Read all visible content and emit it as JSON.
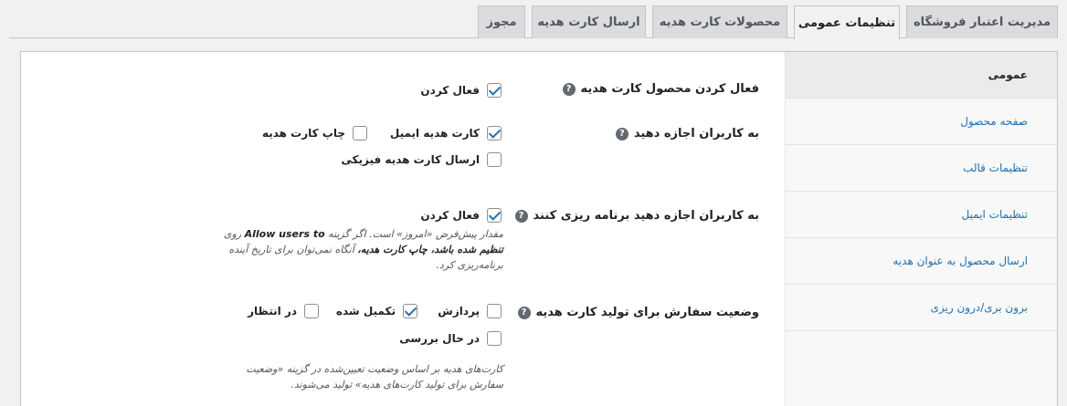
{
  "tabs": [
    {
      "label": "مدیریت اعتبار فروشگاه",
      "active": false
    },
    {
      "label": "تنظیمات عمومی",
      "active": true
    },
    {
      "label": "محصولات کارت هدیه",
      "active": false
    },
    {
      "label": "ارسال کارت هدیه",
      "active": false
    },
    {
      "label": "مجوز",
      "active": false
    }
  ],
  "sidebar": {
    "items": [
      {
        "label": "عمومی",
        "active": true
      },
      {
        "label": "صفحه محصول"
      },
      {
        "label": "تنظیمات قالب"
      },
      {
        "label": "تنظیمات ایمیل"
      },
      {
        "label": "ارسال محصول به عنوان هدیه"
      },
      {
        "label": "برون بری/درون ریزی"
      }
    ]
  },
  "form": {
    "enable_product": {
      "label": "فعال کردن محصول کارت هدیه",
      "option_label": "فعال کردن",
      "checked": true
    },
    "allow_users": {
      "label": "به کاربران اجازه دهید",
      "options": [
        {
          "label": "کارت هدیه ایمیل",
          "checked": true
        },
        {
          "label": "چاپ کارت هدیه",
          "checked": false
        },
        {
          "label": "ارسال کارت هدیه فیزیکی",
          "checked": false
        }
      ]
    },
    "allow_schedule": {
      "label": "به کاربران اجازه دهید برنامه ریزی کنند",
      "option_label": "فعال کردن",
      "checked": true,
      "desc_1": "مقدار پیش‌فرض «امروز» است. اگر گزینه",
      "desc_bold_1": "Allow users to",
      "desc_2": "روی",
      "desc_bold_2": "تنظیم شده باشد، چاپ کارت هدیه،",
      "desc_3": "آنگاه نمی‌توان برای تاریخ",
      "desc_4": "آینده برنامه‌ریزی کرد."
    },
    "order_status": {
      "label": "وضعیت سفارش برای تولید کارت هدیه",
      "options": [
        {
          "label": "پردازش",
          "checked": false
        },
        {
          "label": "تکمیل شده",
          "checked": true
        },
        {
          "label": "در انتظار",
          "checked": false
        },
        {
          "label": "در حال بررسی",
          "checked": false
        }
      ],
      "desc_line1": "کارت‌های هدیه بر اساس وضعیت تعیین‌شده در گزینه «وضعیت",
      "desc_line2": "سفارش برای تولید کارت‌های هدیه» تولید می‌شوند."
    },
    "help_glyph": "?"
  }
}
